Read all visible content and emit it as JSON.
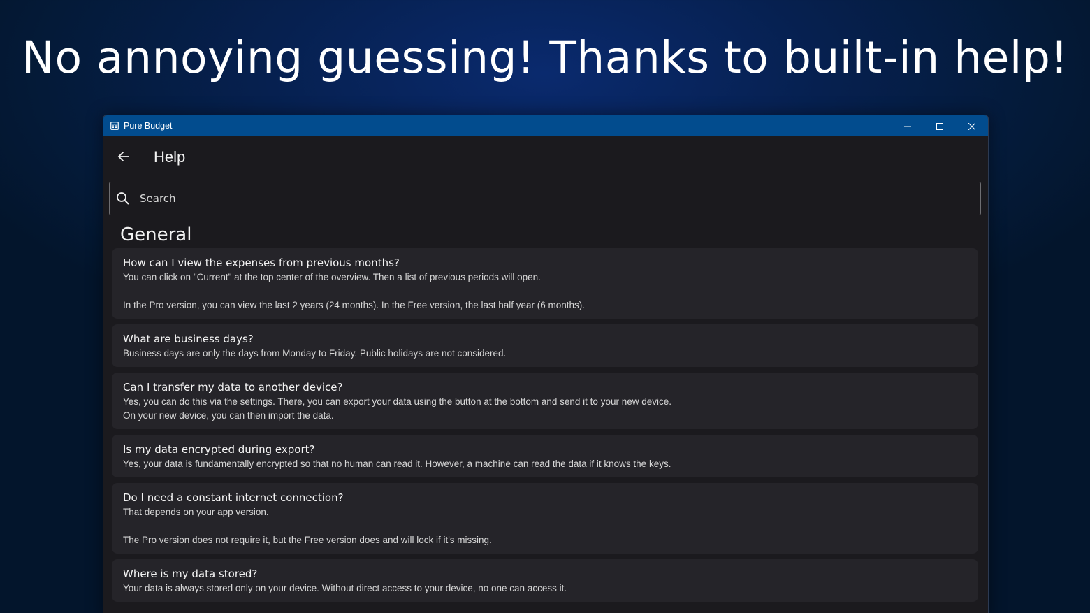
{
  "headline": "No annoying guessing! Thanks to built-in help!",
  "window": {
    "title": "Pure Budget",
    "controls": {
      "minimize_icon": "minimize-icon",
      "maximize_icon": "maximize-icon",
      "close_icon": "close-icon"
    }
  },
  "header": {
    "back_icon": "arrow-left-icon",
    "title": "Help"
  },
  "search": {
    "placeholder": "Search",
    "value": "",
    "icon": "search-icon"
  },
  "section": {
    "title": "General",
    "items": [
      {
        "question": "How can I view the expenses from previous months?",
        "answer": "You can click on \"Current\" at the top center of the overview. Then a list of previous periods will open.\n\nIn the Pro version, you can view the last 2 years (24 months). In the Free version, the last half year (6 months)."
      },
      {
        "question": "What are business days?",
        "answer": "Business days are only the days from Monday to Friday. Public holidays are not considered."
      },
      {
        "question": "Can I transfer my data to another device?",
        "answer": "Yes, you can do this via the settings. There, you can export your data using the button at the bottom and send it to your new device.\nOn your new device, you can then import the data."
      },
      {
        "question": "Is my data encrypted during export?",
        "answer": "Yes, your data is fundamentally encrypted so that no human can read it. However, a machine can read the data if it knows the keys."
      },
      {
        "question": "Do I need a constant internet connection?",
        "answer": "That depends on your app version.\n\nThe Pro version does not require it, but the Free version does and will lock if it's missing."
      },
      {
        "question": "Where is my data stored?",
        "answer": "Your data is always stored only on your device. Without direct access to your device, no one can access it."
      }
    ]
  },
  "colors": {
    "titlebar": "#024c8e",
    "window_bg": "#1b1a1e",
    "card_bg": "#252429",
    "background": "#041a38"
  }
}
